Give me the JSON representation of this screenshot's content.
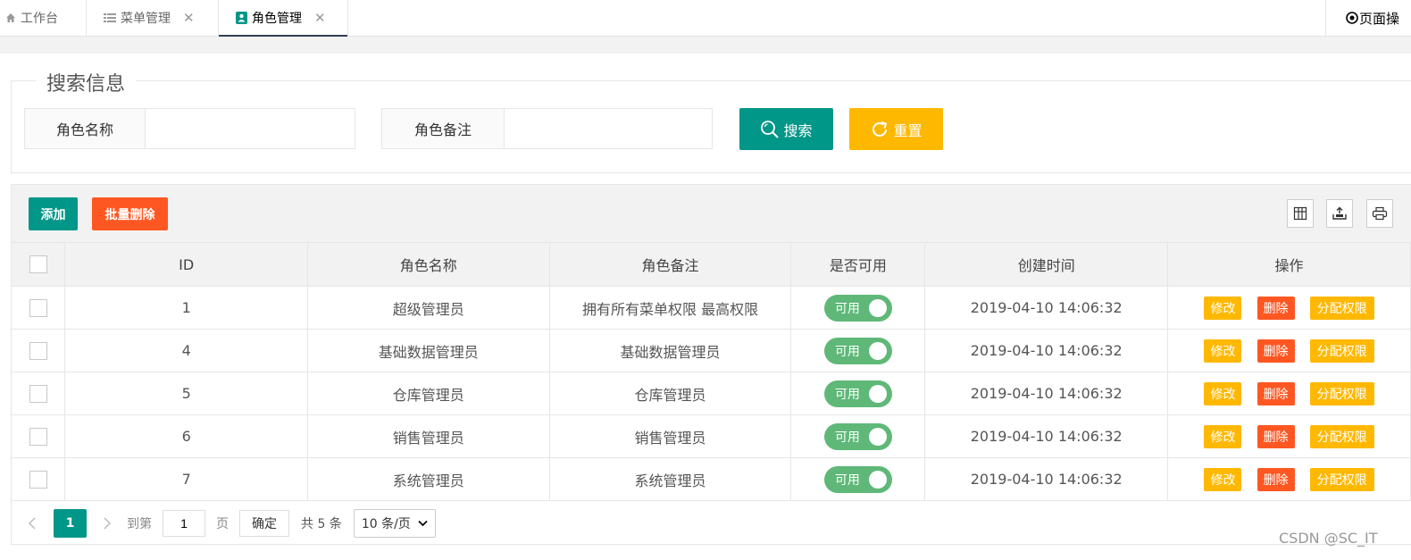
{
  "tabs": [
    {
      "label": "工作台",
      "icon": "home-icon"
    },
    {
      "label": "菜单管理",
      "icon": "list-icon"
    },
    {
      "label": "角色管理",
      "icon": "user-card-icon"
    }
  ],
  "page_op_label": "页面操",
  "search": {
    "legend": "搜索信息",
    "role_name_label": "角色名称",
    "role_name_value": "",
    "role_remark_label": "角色备注",
    "role_remark_value": "",
    "search_button": "搜索",
    "reset_button": "重置"
  },
  "toolbar": {
    "add_button": "添加",
    "batch_delete_button": "批量删除"
  },
  "table": {
    "columns": [
      "ID",
      "角色名称",
      "角色备注",
      "是否可用",
      "创建时间",
      "操作"
    ],
    "rows": [
      {
        "id": "1",
        "name": "超级管理员",
        "remark": "拥有所有菜单权限 最高权限",
        "status": "可用",
        "created": "2019-04-10 14:06:32"
      },
      {
        "id": "4",
        "name": "基础数据管理员",
        "remark": "基础数据管理员",
        "status": "可用",
        "created": "2019-04-10 14:06:32"
      },
      {
        "id": "5",
        "name": "仓库管理员",
        "remark": "仓库管理员",
        "status": "可用",
        "created": "2019-04-10 14:06:32"
      },
      {
        "id": "6",
        "name": "销售管理员",
        "remark": "销售管理员",
        "status": "可用",
        "created": "2019-04-10 14:06:32"
      },
      {
        "id": "7",
        "name": "系统管理员",
        "remark": "系统管理员",
        "status": "可用",
        "created": "2019-04-10 14:06:32"
      }
    ],
    "actions": {
      "edit": "修改",
      "delete": "删除",
      "assign": "分配权限"
    }
  },
  "pager": {
    "current_page": "1",
    "goto_label": "到第",
    "goto_value": "1",
    "page_unit": "页",
    "confirm_button": "确定",
    "total_text": "共 5 条",
    "page_size_selected": "10 条/页"
  },
  "watermark": "CSDN @SC_IT",
  "colors": {
    "teal": "#009688",
    "orange": "#ffb800",
    "red": "#ff5722",
    "switch_on": "#5fb878",
    "tab_underline": "#2f4056"
  }
}
